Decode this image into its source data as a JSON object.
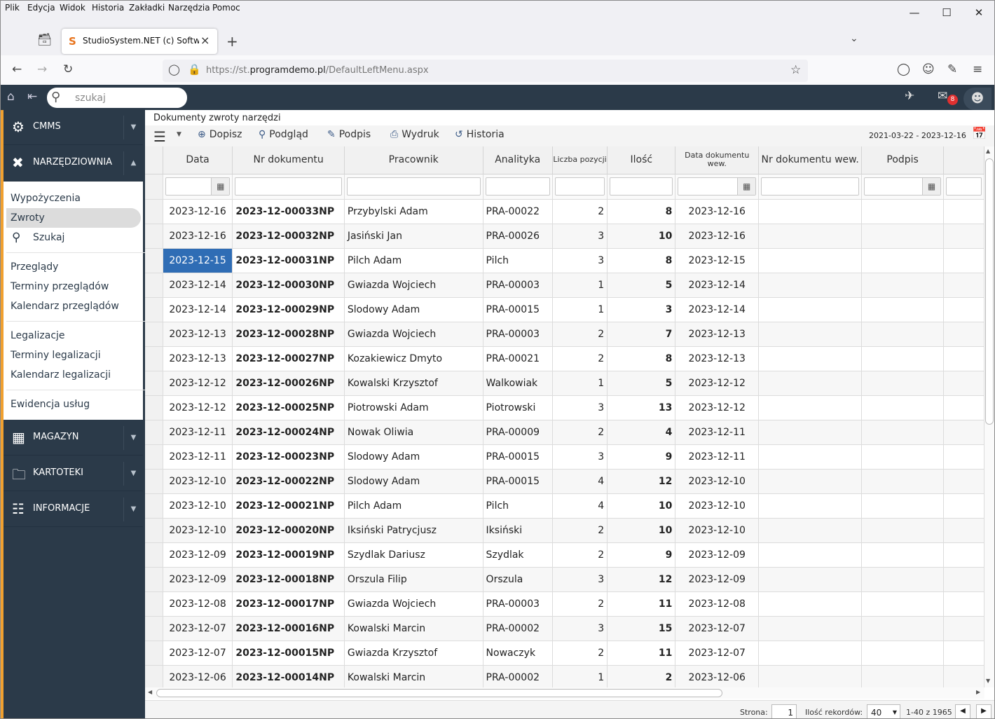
{
  "browser": {
    "menu": [
      "Plik",
      "Edycja",
      "Widok",
      "Historia",
      "Zakładki",
      "Narzędzia",
      "Pomoc"
    ],
    "tab_title": "StudioSystem.NET (c) Software Studio",
    "url_prefix": "https://st.",
    "url_domain": "programdemo.pl",
    "url_path": "/DefaultLeftMenu.aspx"
  },
  "header": {
    "search_placeholder": "szukaj",
    "mail_badge": "8"
  },
  "sidebar": {
    "sections": [
      {
        "label": "CMMS",
        "icon": "gears-icon"
      },
      {
        "label": "NARZĘDZIOWNIA",
        "icon": "tools-icon"
      },
      {
        "label": "MAGAZYN",
        "icon": "pallet-icon"
      },
      {
        "label": "KARTOTEKI",
        "icon": "folder-icon"
      },
      {
        "label": "INFORMACJE",
        "icon": "sitemap-icon"
      }
    ],
    "items": [
      "Wypożyczenia",
      "Zwroty",
      "Szukaj",
      "Przeglądy",
      "Terminy przeglądów",
      "Kalendarz przeglądów",
      "Legalizacje",
      "Terminy legalizacji",
      "Kalendarz legalizacji",
      "Ewidencja usług"
    ]
  },
  "content": {
    "title": "Dokumenty zwroty narzędzi",
    "toolbar": {
      "add": "Dopisz",
      "preview": "Podgląd",
      "sign": "Podpis",
      "print": "Wydruk",
      "history": "Historia"
    },
    "date_range": "2021-03-22 - 2023-12-16",
    "columns": [
      "Data",
      "Nr dokumentu",
      "Pracownik",
      "Analityka",
      "Liczba pozycji",
      "Ilość",
      "Data dokumentu wew.",
      "Nr dokumentu wew.",
      "Podpis"
    ],
    "rows": [
      [
        "2023-12-16",
        "2023-12-00033NP",
        "Przybylski Adam",
        "PRA-00022",
        "2",
        "8",
        "2023-12-16"
      ],
      [
        "2023-12-16",
        "2023-12-00032NP",
        "Jasiński Jan",
        "PRA-00026",
        "3",
        "10",
        "2023-12-16"
      ],
      [
        "2023-12-15",
        "2023-12-00031NP",
        "Pilch Adam",
        "Pilch",
        "3",
        "8",
        "2023-12-15"
      ],
      [
        "2023-12-14",
        "2023-12-00030NP",
        "Gwiazda Wojciech",
        "PRA-00003",
        "1",
        "5",
        "2023-12-14"
      ],
      [
        "2023-12-14",
        "2023-12-00029NP",
        "Slodowy Adam",
        "PRA-00015",
        "1",
        "3",
        "2023-12-14"
      ],
      [
        "2023-12-13",
        "2023-12-00028NP",
        "Gwiazda Wojciech",
        "PRA-00003",
        "2",
        "7",
        "2023-12-13"
      ],
      [
        "2023-12-13",
        "2023-12-00027NP",
        "Kozakiewicz Dmyto",
        "PRA-00021",
        "2",
        "8",
        "2023-12-13"
      ],
      [
        "2023-12-12",
        "2023-12-00026NP",
        "Kowalski Krzysztof",
        "Walkowiak",
        "1",
        "5",
        "2023-12-12"
      ],
      [
        "2023-12-12",
        "2023-12-00025NP",
        "Piotrowski Adam",
        "Piotrowski",
        "3",
        "13",
        "2023-12-12"
      ],
      [
        "2023-12-11",
        "2023-12-00024NP",
        "Nowak Oliwia",
        "PRA-00009",
        "2",
        "4",
        "2023-12-11"
      ],
      [
        "2023-12-11",
        "2023-12-00023NP",
        "Slodowy Adam",
        "PRA-00015",
        "3",
        "9",
        "2023-12-11"
      ],
      [
        "2023-12-10",
        "2023-12-00022NP",
        "Slodowy Adam",
        "PRA-00015",
        "4",
        "12",
        "2023-12-10"
      ],
      [
        "2023-12-10",
        "2023-12-00021NP",
        "Pilch Adam",
        "Pilch",
        "4",
        "10",
        "2023-12-10"
      ],
      [
        "2023-12-10",
        "2023-12-00020NP",
        "Iksiński Patrycjusz",
        "Iksiński",
        "2",
        "10",
        "2023-12-10"
      ],
      [
        "2023-12-09",
        "2023-12-00019NP",
        "Szydlak Dariusz",
        "Szydlak",
        "2",
        "9",
        "2023-12-09"
      ],
      [
        "2023-12-09",
        "2023-12-00018NP",
        "Orszula Filip",
        "Orszula",
        "3",
        "12",
        "2023-12-09"
      ],
      [
        "2023-12-08",
        "2023-12-00017NP",
        "Gwiazda Wojciech",
        "PRA-00003",
        "2",
        "11",
        "2023-12-08"
      ],
      [
        "2023-12-07",
        "2023-12-00016NP",
        "Kowalski Marcin",
        "PRA-00002",
        "3",
        "15",
        "2023-12-07"
      ],
      [
        "2023-12-07",
        "2023-12-00015NP",
        "Gwiazda Krzysztof",
        "Nowaczyk",
        "2",
        "11",
        "2023-12-07"
      ],
      [
        "2023-12-06",
        "2023-12-00014NP",
        "Kowalski Marcin",
        "PRA-00002",
        "1",
        "2",
        "2023-12-06"
      ]
    ],
    "selected_row": 2
  },
  "pager": {
    "page_label": "Strona:",
    "page_value": "1",
    "records_label": "Ilość rekordów:",
    "records_value": "40",
    "range_text": "1-40 z 1965"
  }
}
